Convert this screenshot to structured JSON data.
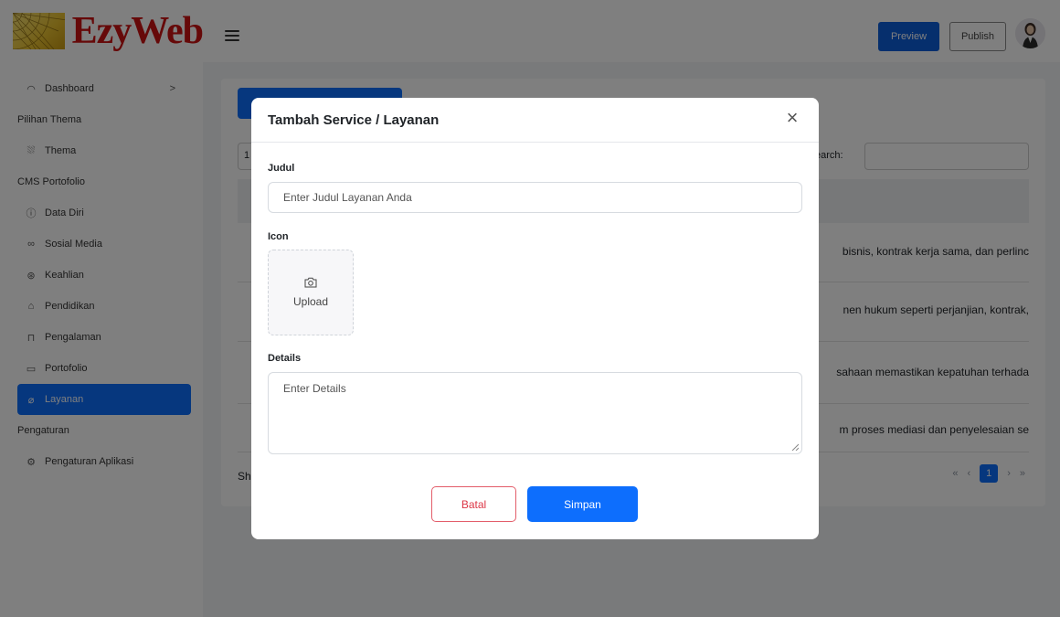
{
  "header": {
    "logo_text": "EzyWeb",
    "preview_label": "Preview",
    "publish_label": "Publish"
  },
  "sidebar": {
    "items": [
      {
        "type": "item",
        "label": "Dashboard",
        "icon": "dashboard-icon",
        "glyph": "◠",
        "chevron": ">"
      },
      {
        "type": "group",
        "label": "Pilihan Thema"
      },
      {
        "type": "item",
        "label": "Thema",
        "icon": "theme-icon",
        "glyph": "⛆"
      },
      {
        "type": "group",
        "label": "CMS Portofolio"
      },
      {
        "type": "item",
        "label": "Data Diri",
        "icon": "info-icon",
        "glyph": "ⓘ"
      },
      {
        "type": "item",
        "label": "Sosial Media",
        "icon": "link-icon",
        "glyph": "∞"
      },
      {
        "type": "item",
        "label": "Keahlian",
        "icon": "star-icon",
        "glyph": "⊛"
      },
      {
        "type": "item",
        "label": "Pendidikan",
        "icon": "graduation-cap-icon",
        "glyph": "⌂"
      },
      {
        "type": "item",
        "label": "Pengalaman",
        "icon": "briefcase-icon",
        "glyph": "⊓"
      },
      {
        "type": "item",
        "label": "Portofolio",
        "icon": "folder-icon",
        "glyph": "▭"
      },
      {
        "type": "item",
        "label": "Layanan",
        "icon": "layanan-icon",
        "glyph": "⌀",
        "active": true
      },
      {
        "type": "group",
        "label": "Pengaturan"
      },
      {
        "type": "item",
        "label": "Pengaturan Aplikasi",
        "icon": "settings-icon",
        "glyph": "⚙"
      }
    ]
  },
  "background_table": {
    "length_value": "1",
    "search_label": "earch:",
    "rows": [
      " bisnis, kontrak kerja sama, dan perlinc",
      "nen hukum seperti perjanjian, kontrak, ",
      "sahaan memastikan kepatuhan terhada",
      "m proses mediasi dan penyelesaian se"
    ],
    "show_label": "Sh",
    "pager": {
      "first": "«",
      "prev": "‹",
      "current": "1",
      "next": "›",
      "last": "»"
    }
  },
  "modal": {
    "title": "Tambah Service / Layanan",
    "close_glyph": "×",
    "judul_label": "Judul",
    "judul_placeholder": "Enter Judul Layanan Anda",
    "icon_label": "Icon",
    "upload_label": "Upload",
    "details_label": "Details",
    "details_placeholder": "Enter Details",
    "batal_label": "Batal",
    "simpan_label": "Simpan"
  },
  "colors": {
    "primary": "#0d6efd",
    "danger": "#dc3545",
    "logo_red": "#cc1212"
  }
}
